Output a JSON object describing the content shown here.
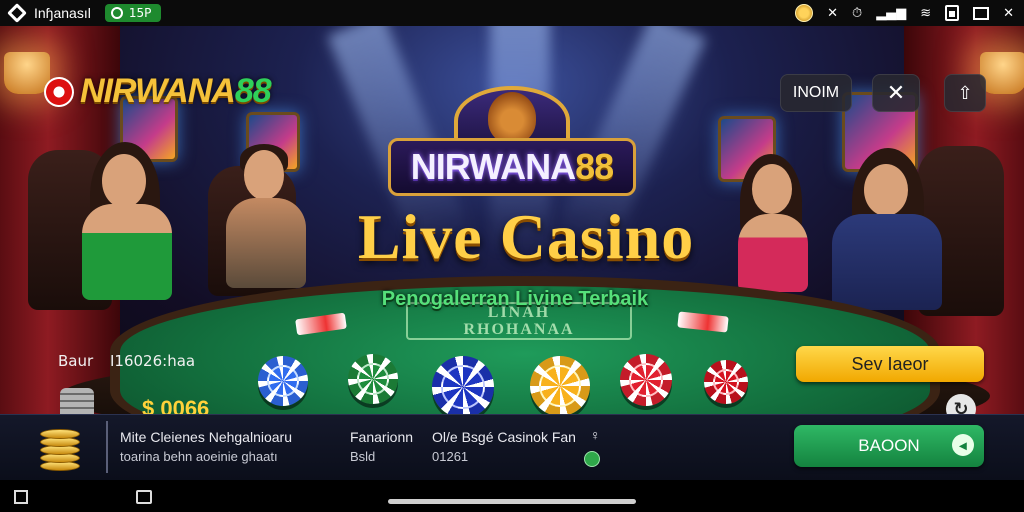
{
  "status_bar": {
    "carrier": "Inɧanasıl",
    "pill_text": "15P",
    "icons": [
      "coin-icon",
      "wrench-icon",
      "clock-icon",
      "signal-icon",
      "wifi-icon",
      "battery-icon",
      "window-icon",
      "close-icon"
    ]
  },
  "header": {
    "logo_text": "NIRWANA",
    "logo_num": "88",
    "btn_label": "INOIM",
    "close_glyph": "✕",
    "exit_glyph": "⇧"
  },
  "crest": {
    "text": "NIRWANA",
    "num": "88"
  },
  "hero": {
    "title": "Live Casino",
    "subtitle": "Penogalerran Livine Terbaik",
    "felt_line1": "LINAH",
    "felt_line2": "RHOHANAA"
  },
  "betting": {
    "label": "Baur",
    "code": "I16026:haa",
    "balance": "$ 0066",
    "chip_colors": [
      "#2b5fd0",
      "#1b7a35",
      "#1a2fa8",
      "#d89a18",
      "#c41c2a",
      "#b8101c"
    ],
    "action_label": "Sev Iaeor",
    "refresh_glyph": "↻"
  },
  "info_bar": {
    "line1_a": "Mite Cleienes Nehgalnioaru",
    "line1_b": "toarina behn aoeinie ghaatı",
    "line2_a": "Fanarionn",
    "line2_b": "Bsld",
    "line3_a": "Ol/e Bsgé Casinok Fan",
    "line3_b": "01261",
    "pin_glyph": "♀",
    "cta_label": "BAOON",
    "cta_arrow": "◂"
  },
  "colors": {
    "gold": "#ffcf47",
    "green": "#2fb865",
    "felt": "#13703e"
  }
}
